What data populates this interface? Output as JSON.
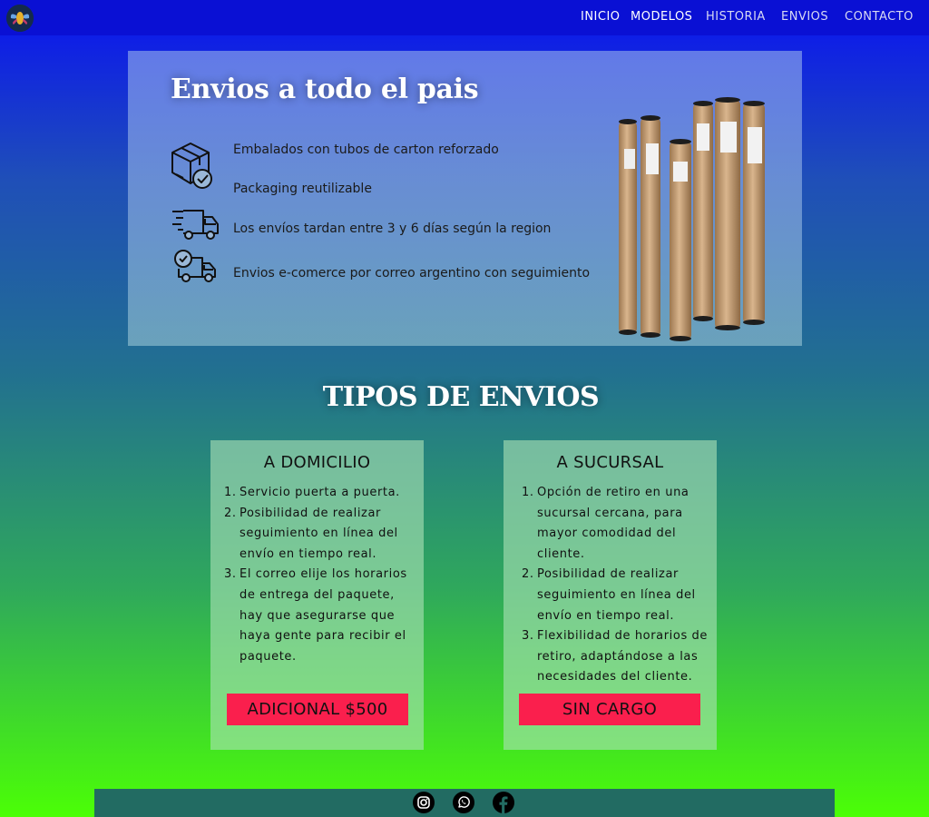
{
  "nav": {
    "links": [
      "INICIO",
      "MODELOS",
      "HISTORIA",
      "ENVIOS",
      "CONTACTO"
    ]
  },
  "hero": {
    "title": "Envios a todo el pais",
    "features": [
      {
        "text": "Embalados con tubos de carton reforzado",
        "icon": "package-check-icon"
      },
      {
        "text": "Packaging reutilizable",
        "icon": ""
      },
      {
        "text": "Los envíos tardan entre 3 y 6 días según la region",
        "icon": "fast-truck-icon"
      },
      {
        "text": "Envios e-comerce por correo argentino con seguimiento",
        "icon": "truck-clock-icon"
      }
    ],
    "image": "shipping-tubes"
  },
  "section": {
    "title": "TIPOS DE ENVIOS"
  },
  "cards": [
    {
      "title": "A DOMICILIO",
      "items": [
        "Servicio puerta a puerta.",
        "Posibilidad de realizar seguimiento en línea del envío en tiempo real.",
        "El correo elije los horarios de entrega del paquete, hay que asegurarse que haya gente para recibir el paquete."
      ],
      "price": "ADICIONAL $500"
    },
    {
      "title": "A SUCURSAL",
      "items": [
        "Opción de retiro en una sucursal cercana, para mayor comodidad del cliente.",
        "Posibilidad de realizar seguimiento en línea del envío en tiempo real.",
        "Flexibilidad de horarios de retiro, adaptándose a las necesidades del cliente."
      ],
      "price": "SIN CARGO"
    }
  ],
  "footer": {
    "icons": [
      "instagram-icon",
      "whatsapp-icon",
      "facebook-icon"
    ]
  },
  "colors": {
    "nav_bg": "#0a10d4",
    "price_button": "#fa1f4d",
    "footer_bg": "#226b62"
  }
}
